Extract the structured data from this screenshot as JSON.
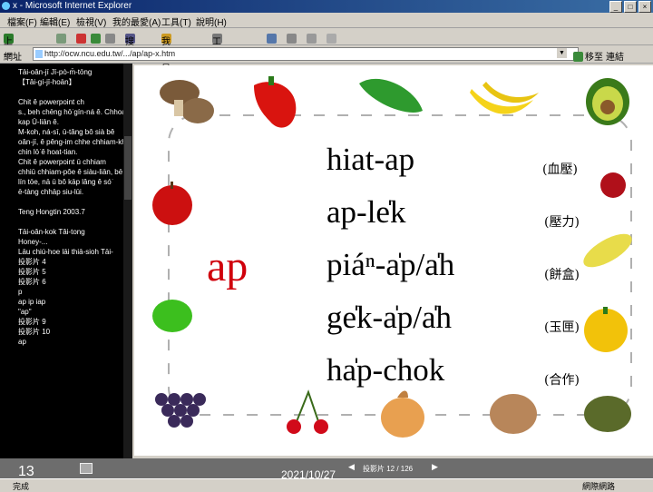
{
  "window": {
    "title": "x - Microsoft Internet Explorer"
  },
  "menu": [
    "檔案(F)",
    "編輯(E)",
    "檢視(V)",
    "我的最愛(A)",
    "工具(T)",
    "說明(H)"
  ],
  "toolbar": {
    "back": "上一頁",
    "search": "搜尋",
    "favorites": "我的最愛",
    "tools": "工具"
  },
  "address": {
    "label": "網址",
    "url": "http://ocw.ncu.edu.tw/.../ap/ap-x.htm",
    "go": "移至",
    "links": "連結"
  },
  "sidebar": {
    "lines": [
      "Tāi-oân-jī Jī-pò-m̄-tōng",
      "【Tâi-gí-jī-hoān】",
      "",
      "Chit ê powerpoint ch",
      "s., beh chēng hō͘ gín-ná ê. Chhoán",
      "kap Ū-liān ê.",
      "M-koh, ná-sī, ū-tâng bô sià bê",
      "oân-jī, ê pêng-im chhe chhiam-kh",
      "chin lō͘ ê hoat-tian.",
      "Chit ê powerpoint ū chhiam",
      "chhiū chhiam-pôe ê siàu-liān, bē",
      "lín tōe, nā ū bô kāp lâng ê só͘",
      "ē-tàng chhāp siu-lūi.",
      "",
      "Teng Hongtin 2003.7",
      "",
      "Tāi-oân-kok Tâi-tong",
      "Honey-...",
      "Lāu chiú-hoe lāi thiā-sioh Tāi-",
      "投影片 4",
      "投影片 5",
      "投影片 6",
      "p",
      "ap   ip   iap",
      "\"ap\"",
      "投影片 9",
      "投影片 10",
      "ap"
    ]
  },
  "slide": {
    "number": "13",
    "date": "2021/10/27",
    "page_info": "投影片 12 / 126",
    "main_word": "ap",
    "words": [
      {
        "text": "hiat-ap",
        "gloss": "(血壓)"
      },
      {
        "text": "ap-le̍k",
        "gloss": "(壓力)"
      },
      {
        "text": "piáⁿ-a̍p/a̍h",
        "gloss": "(餅盒)"
      },
      {
        "text": "ge̍k-a̍p/a̍h",
        "gloss": "(玉匣)"
      },
      {
        "text": "ha̍p-chok",
        "gloss": "(合作)"
      }
    ]
  },
  "colors": {
    "title_bar": "#0a246a",
    "main_word": "#d0000c",
    "sidebar_bg": "#000000",
    "chrome": "#d4d0c8"
  },
  "status": {
    "left": "完成",
    "right": "網際網路"
  }
}
